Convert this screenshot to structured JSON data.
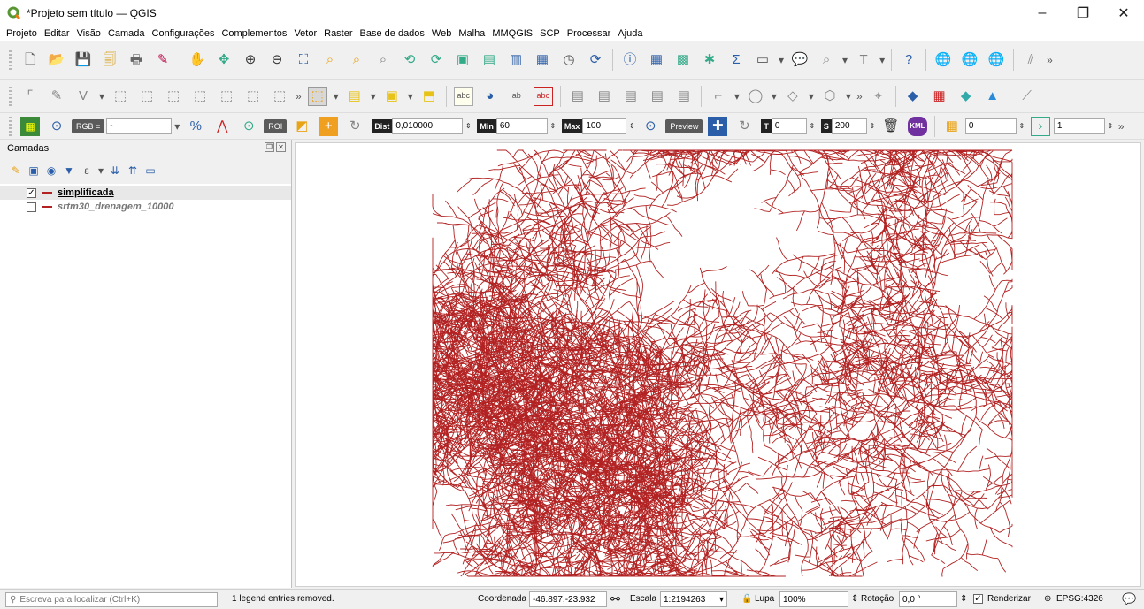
{
  "window": {
    "title": "*Projeto sem título — QGIS",
    "minimize": "–",
    "restore": "❐",
    "close": "✕"
  },
  "menu": [
    "Projeto",
    "Editar",
    "Visão",
    "Camada",
    "Configurações",
    "Complementos",
    "Vetor",
    "Raster",
    "Base de dados",
    "Web",
    "Malha",
    "MMQGIS",
    "SCP",
    "Processar",
    "Ajuda"
  ],
  "toolbar3": {
    "rgb_label": "RGB =",
    "rgb_value": "-",
    "roi_label": "ROI",
    "dist_label": "Dist",
    "dist_value": "0,010000",
    "min_label": "Min",
    "min_value": "60",
    "max_label": "Max",
    "max_value": "100",
    "preview_label": "Preview",
    "t_label": "T",
    "t_value": "0",
    "s_label": "S",
    "s_value": "200",
    "kml_label": "KML",
    "band_value": "0",
    "step_value": "1"
  },
  "panel": {
    "title": "Camadas",
    "layers": [
      {
        "name": "simplificada",
        "checked": "✓"
      },
      {
        "name": "srtm30_drenagem_10000",
        "checked": ""
      }
    ]
  },
  "status": {
    "locator_placeholder": "Escreva para localizar (Ctrl+K)",
    "message": "1 legend entries removed.",
    "coord_label": "Coordenada",
    "coord_value": "-46.897,-23.932",
    "scale_label": "Escala",
    "scale_value": "1:2194263",
    "magnifier_label": "Lupa",
    "magnifier_value": "100%",
    "rotation_label": "Rotação",
    "rotation_value": "0,0 °",
    "render_label": "Renderizar",
    "render_check": "✓",
    "crs": "EPSG:4326"
  },
  "colors": {
    "drainage": "#b22222",
    "accent": "#589632"
  }
}
